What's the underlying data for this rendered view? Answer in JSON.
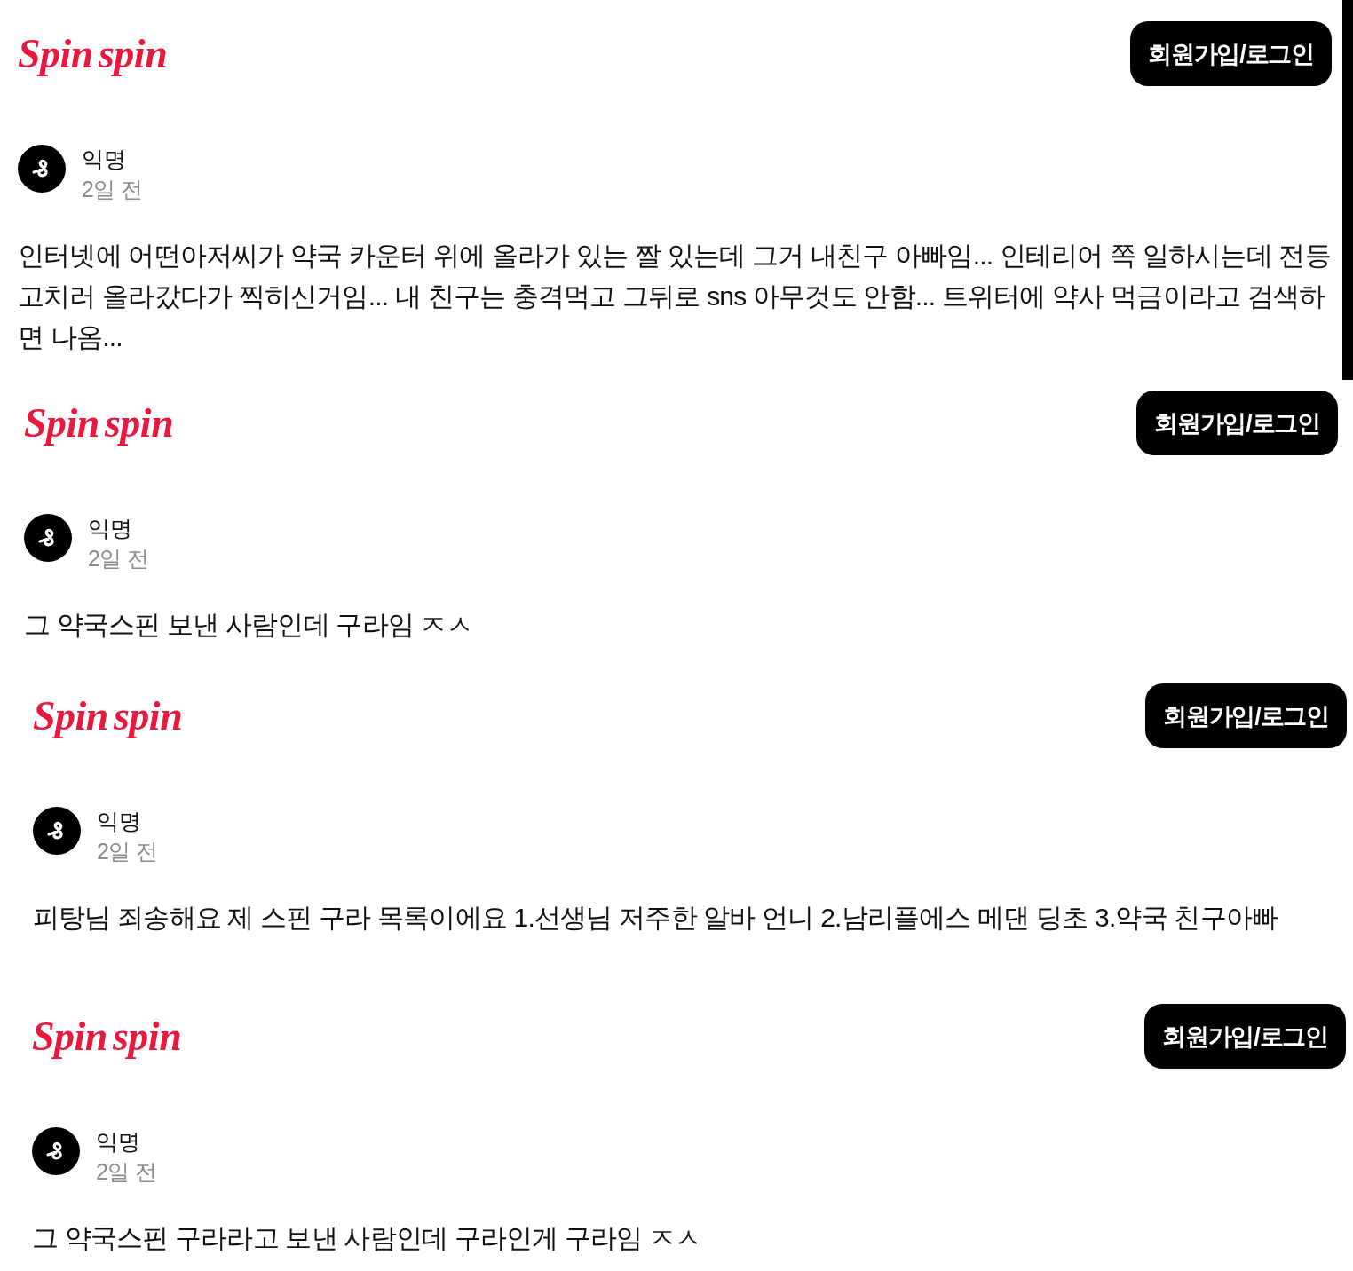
{
  "screens": [
    {
      "header": {
        "logo": "Spin spin",
        "button": "회원가입/로그인"
      },
      "post": {
        "author": "익명",
        "time": "2일 전",
        "text": "인터넷에 어떤아저씨가 약국 카운터 위에 올라가 있는 짤 있는데 그거 내친구 아빠임... 인테리어 쪽 일하시는데 전등 고치러 올라갔다가 찍히신거임... 내 친구는 충격먹고 그뒤로 sns 아무것도 안함... 트위터에 약사 먹금이라고 검색하면 나옴..."
      },
      "scrollbar": true
    },
    {
      "header": {
        "logo": "Spin spin",
        "button": "회원가입/로그인"
      },
      "post": {
        "author": "익명",
        "time": "2일 전",
        "text": "그 약국스핀 보낸 사람인데 구라임 ㅈㅅ"
      },
      "scrollbar": false
    },
    {
      "header": {
        "logo": "Spin spin",
        "button": "회원가입/로그인"
      },
      "post": {
        "author": "익명",
        "time": "2일 전",
        "text": "피탕님 죄송해요 제 스핀 구라 목록이에요 1.선생님 저주한 알바 언니 2.남리플에스 메댄 딩초 3.약국 친구아빠"
      },
      "scrollbar": false
    },
    {
      "header": {
        "logo": "Spin spin",
        "button": "회원가입/로그인"
      },
      "post": {
        "author": "익명",
        "time": "2일 전",
        "text": "그 약국스핀 구라라고 보낸 사람인데 구라인게 구라임 ㅈㅅ"
      },
      "scrollbar": false
    }
  ]
}
